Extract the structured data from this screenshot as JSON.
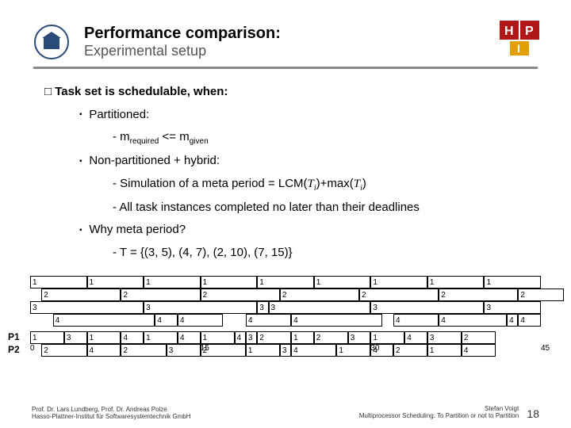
{
  "header": {
    "title": "Performance comparison:",
    "subtitle": "Experimental setup"
  },
  "bullets": {
    "root": "Task set is schedulable, when:",
    "partitioned": "Partitioned:",
    "mreq": "m",
    "mreq_sub": "required",
    "mreq_op": " <= m",
    "mgiv_sub": "given",
    "nonpart": "Non-partitioned + hybrid:",
    "sim_a": "Simulation of a meta period = LCM(",
    "sim_t": "T",
    "sim_i": "i",
    "sim_b": ")+max(",
    "sim_c": ")",
    "deadline": "All task instances completed no later than their deadlines",
    "why": "Why meta period?",
    "tset": "T = {(3, 5), (4, 7), (2, 10), (7, 15)}"
  },
  "chart_data": {
    "type": "table",
    "unit_width": 45,
    "axis_ticks": [
      0,
      15,
      30,
      45
    ],
    "rows": [
      {
        "label": "",
        "cells": [
          {
            "s": 0,
            "w": 5,
            "v": "1"
          },
          {
            "s": 5,
            "w": 5,
            "v": "1"
          },
          {
            "s": 10,
            "w": 5,
            "v": "1"
          },
          {
            "s": 15,
            "w": 5,
            "v": "1"
          },
          {
            "s": 20,
            "w": 5,
            "v": "1"
          },
          {
            "s": 25,
            "w": 5,
            "v": "1"
          },
          {
            "s": 30,
            "w": 5,
            "v": "1"
          },
          {
            "s": 35,
            "w": 5,
            "v": "1"
          },
          {
            "s": 40,
            "w": 5,
            "v": "1"
          }
        ]
      },
      {
        "label": "",
        "cells": [
          {
            "s": 1,
            "w": 7,
            "v": "2"
          },
          {
            "s": 8,
            "w": 7,
            "v": "2"
          },
          {
            "s": 15,
            "w": 7,
            "v": "2"
          },
          {
            "s": 22,
            "w": 7,
            "v": "2"
          },
          {
            "s": 29,
            "w": 7,
            "v": "2"
          },
          {
            "s": 36,
            "w": 7,
            "v": "2"
          },
          {
            "s": 43,
            "w": 4,
            "v": "2"
          }
        ]
      },
      {
        "label": "",
        "cells": [
          {
            "s": 0,
            "w": 10,
            "v": "3"
          },
          {
            "s": 10,
            "w": 10,
            "v": "3"
          },
          {
            "s": 20,
            "w": 1,
            "v": "3"
          },
          {
            "s": 21,
            "w": 9,
            "v": "3"
          },
          {
            "s": 30,
            "w": 10,
            "v": "3"
          },
          {
            "s": 40,
            "w": 5,
            "v": "3"
          }
        ]
      },
      {
        "label": "",
        "cells": [
          {
            "s": 2,
            "w": 9,
            "v": "4"
          },
          {
            "s": 11,
            "w": 2,
            "v": "4"
          },
          {
            "s": 13,
            "w": 4,
            "v": "4"
          },
          {
            "s": 19,
            "w": 4,
            "v": "4"
          },
          {
            "s": 23,
            "w": 8,
            "v": "4"
          },
          {
            "s": 32,
            "w": 4,
            "v": "4"
          },
          {
            "s": 36,
            "w": 6,
            "v": "4"
          },
          {
            "s": 42,
            "w": 1,
            "v": "4"
          },
          {
            "s": 43,
            "w": 2,
            "v": "4"
          }
        ]
      },
      {
        "label": "P1",
        "cells": [
          {
            "s": 0,
            "w": 3,
            "v": "1"
          },
          {
            "s": 3,
            "w": 2,
            "v": "3"
          },
          {
            "s": 5,
            "w": 3,
            "v": "1"
          },
          {
            "s": 8,
            "w": 2,
            "v": "4"
          },
          {
            "s": 10,
            "w": 3,
            "v": "1"
          },
          {
            "s": 13,
            "w": 2,
            "v": "4"
          },
          {
            "s": 15,
            "w": 3,
            "v": "1"
          },
          {
            "s": 18,
            "w": 1,
            "v": "4"
          },
          {
            "s": 19,
            "w": 1,
            "v": "3"
          },
          {
            "s": 20,
            "w": 3,
            "v": "2"
          },
          {
            "s": 23,
            "w": 2,
            "v": "1"
          },
          {
            "s": 25,
            "w": 3,
            "v": "2"
          },
          {
            "s": 28,
            "w": 2,
            "v": "3"
          },
          {
            "s": 30,
            "w": 3,
            "v": "1"
          },
          {
            "s": 33,
            "w": 2,
            "v": "4"
          },
          {
            "s": 35,
            "w": 3,
            "v": "3"
          },
          {
            "s": 38,
            "w": 3,
            "v": "2"
          }
        ]
      },
      {
        "label": "P2",
        "cells": [
          {
            "s": 1,
            "w": 4,
            "v": "2"
          },
          {
            "s": 5,
            "w": 3,
            "v": "4"
          },
          {
            "s": 8,
            "w": 4,
            "v": "2"
          },
          {
            "s": 12,
            "w": 3,
            "v": "3"
          },
          {
            "s": 15,
            "w": 4,
            "v": "2"
          },
          {
            "s": 19,
            "w": 3,
            "v": "1"
          },
          {
            "s": 22,
            "w": 1,
            "v": "3"
          },
          {
            "s": 23,
            "w": 4,
            "v": "4"
          },
          {
            "s": 27,
            "w": 3,
            "v": "1"
          },
          {
            "s": 30,
            "w": 2,
            "v": "4"
          },
          {
            "s": 32,
            "w": 3,
            "v": "2"
          },
          {
            "s": 35,
            "w": 3,
            "v": "1"
          },
          {
            "s": 38,
            "w": 3,
            "v": "4"
          }
        ]
      }
    ]
  },
  "footer": {
    "left1": "Prof. Dr. Lars Lundberg,  Prof. Dr. Andreas Polze",
    "left2": "Hasso-Plattner-Institut für Softwaresystemtechnik GmbH",
    "right1": "Stefan Voigt",
    "right2": "Multiprocessor Scheduling: To Partition or not to Partition",
    "page": "18"
  }
}
